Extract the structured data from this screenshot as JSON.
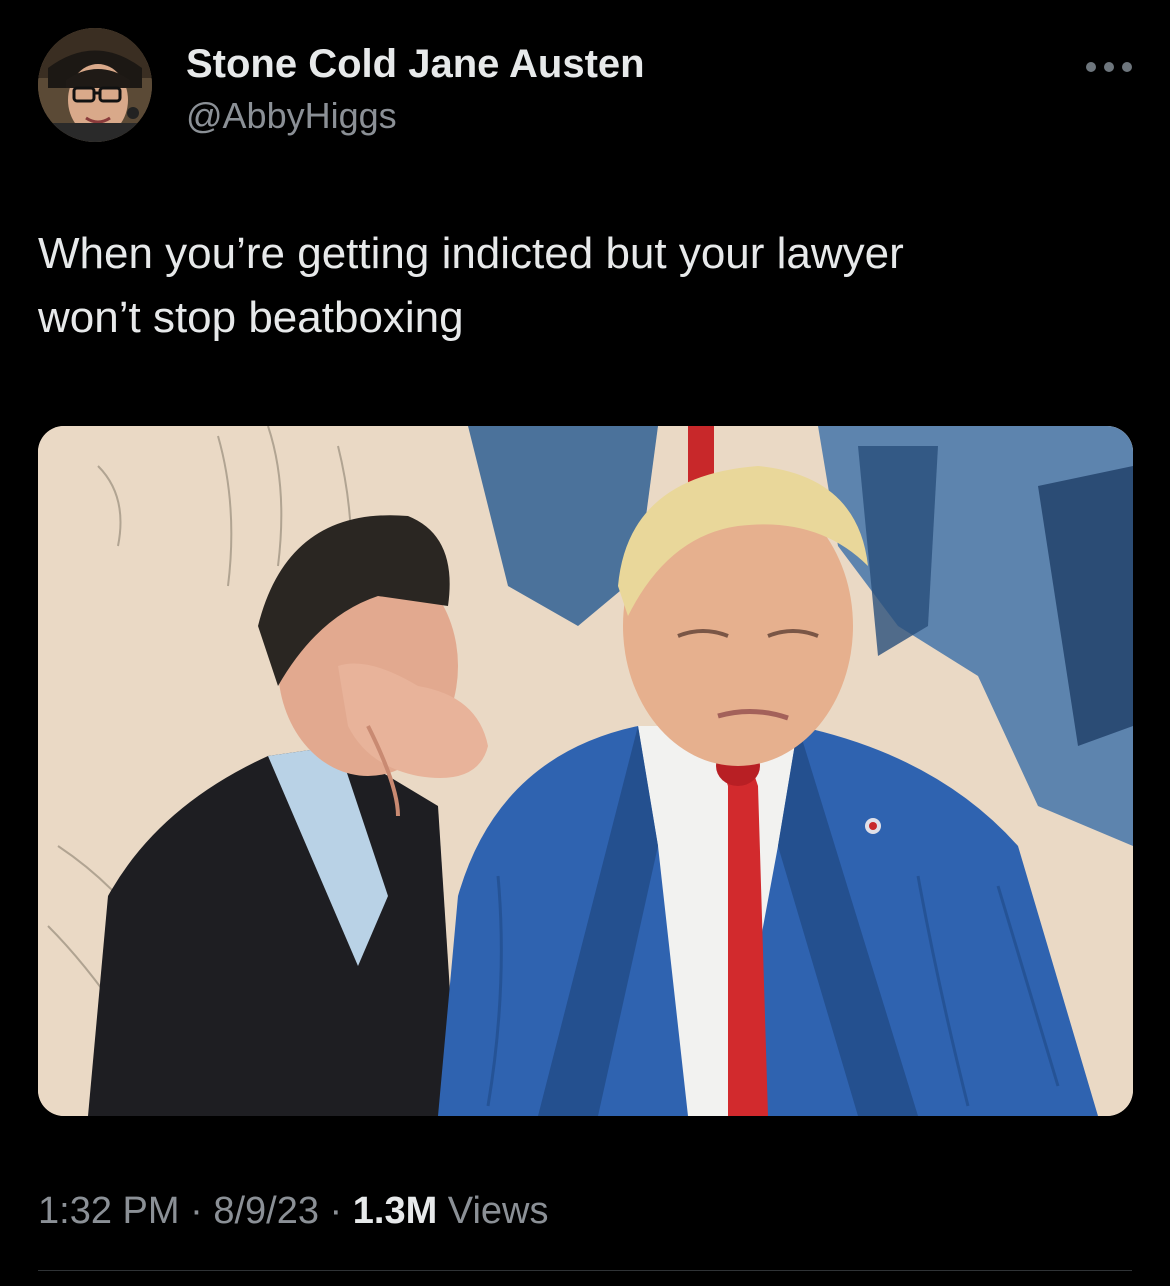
{
  "author": {
    "display_name": "Stone Cold Jane Austen",
    "handle": "@AbbyHiggs",
    "avatar_icon": "profile-photo"
  },
  "more_icon": "more-dots-icon",
  "tweet": {
    "text": "When you’re getting indicted but your lawyer\nwon’t stop beatboxing"
  },
  "media": {
    "type": "image",
    "description_icon": "courtroom-sketch-image"
  },
  "meta": {
    "time": "1:32 PM",
    "separator1": " · ",
    "date": "8/9/23",
    "separator2": " · ",
    "views_count": "1.3M",
    "views_label": " Views"
  },
  "colors": {
    "background": "#000000",
    "primary_text": "#e7e9ea",
    "secondary_text": "#8b9096",
    "divider": "#2f3336"
  }
}
